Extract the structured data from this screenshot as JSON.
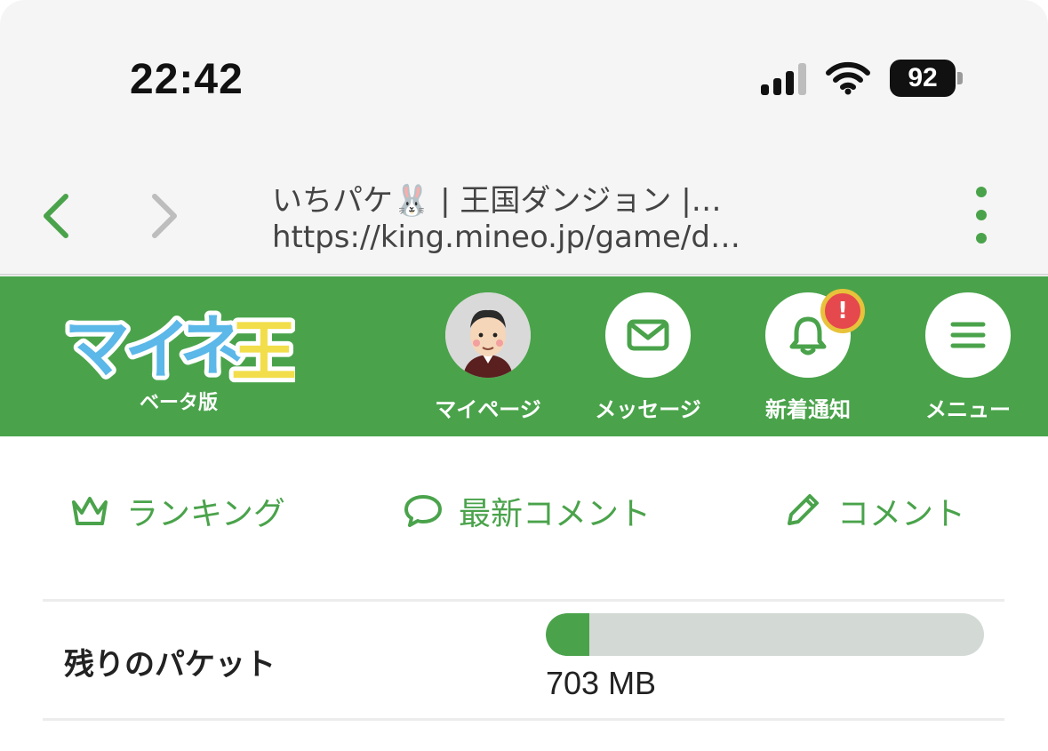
{
  "status_bar": {
    "time": "22:42",
    "battery": "92",
    "icons": [
      "cellular-signal-icon",
      "wifi-icon",
      "battery-icon"
    ]
  },
  "browser": {
    "page_title": "いちパケ🐰 | 王国ダンジョン |…",
    "url": "https://king.mineo.jp/game/d…",
    "icons": [
      "back-arrow-icon",
      "forward-arrow-icon",
      "kebab-menu-icon"
    ]
  },
  "header": {
    "logo_text": "マイネ王",
    "logo_subtitle": "ベータ版",
    "nav": [
      {
        "label": "マイページ",
        "icon": "avatar"
      },
      {
        "label": "メッセージ",
        "icon": "envelope-icon"
      },
      {
        "label": "新着通知",
        "icon": "bell-icon",
        "badge": "!"
      },
      {
        "label": "メニュー",
        "icon": "hamburger-icon"
      }
    ]
  },
  "tabs": [
    {
      "label": "ランキング",
      "icon": "crown-icon"
    },
    {
      "label": "最新コメント",
      "icon": "speech-bubble-icon"
    },
    {
      "label": "コメント",
      "icon": "pencil-icon"
    }
  ],
  "packet": {
    "label": "残りのパケット",
    "value": "703 MB",
    "progress_fraction": 0.1
  },
  "colors": {
    "brand_green": "#4aa34b",
    "progress_track": "#d3d9d5",
    "alert_red": "#e5484d",
    "alert_ring": "#e8c23a"
  }
}
